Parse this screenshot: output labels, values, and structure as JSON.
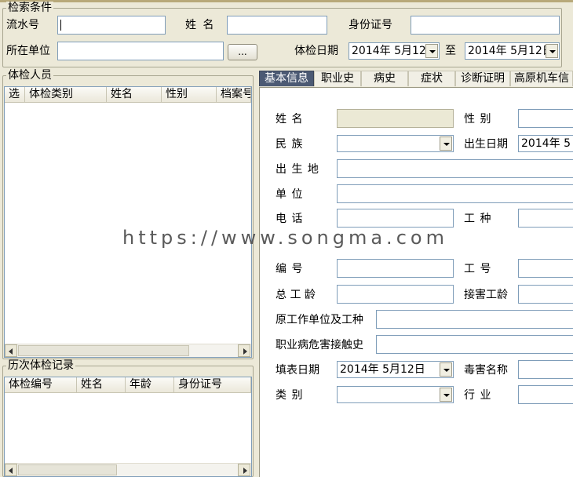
{
  "search": {
    "legend": "检索条件",
    "serial_label": "流水号",
    "name_label": "姓  名",
    "idcard_label": "身份证号",
    "unit_label": "所在单位",
    "browse_button": "...",
    "date_label": "体检日期",
    "date_from": "2014年  5月12",
    "date_to_label": "至",
    "date_to": "2014年  5月12日"
  },
  "people": {
    "legend": "体检人员",
    "columns": [
      "选",
      "体检类别",
      "姓名",
      "性别",
      "档案号"
    ]
  },
  "history": {
    "legend": "历次体检记录",
    "columns": [
      "体检编号",
      "姓名",
      "年龄",
      "身份证号"
    ]
  },
  "tabs": [
    "基本信息",
    "职业史",
    "病史",
    "症状",
    "诊断证明",
    "高原机车信"
  ],
  "form": {
    "name_label": "姓    名",
    "gender_label": "性    别",
    "ethnicity_label": "民    族",
    "birthdate_label": "出生日期",
    "birthdate_value": "2014年  5",
    "birthplace_label": "出 生 地",
    "unit_label": "单    位",
    "phone_label": "电    话",
    "worktype_label": "工    种",
    "number_label": "编    号",
    "workno_label": "工    号",
    "total_years_label": "总 工 龄",
    "exposure_years_label": "接害工龄",
    "orig_unit_label": "原工作单位及工种",
    "hazard_history_label": "职业病危害接触史",
    "fill_date_label": "填表日期",
    "fill_date_value": "2014年  5月12日",
    "poison_label": "毒害名称",
    "category_label": "类    别",
    "industry_label": "行    业"
  },
  "watermark": "https://www.songma.com"
}
